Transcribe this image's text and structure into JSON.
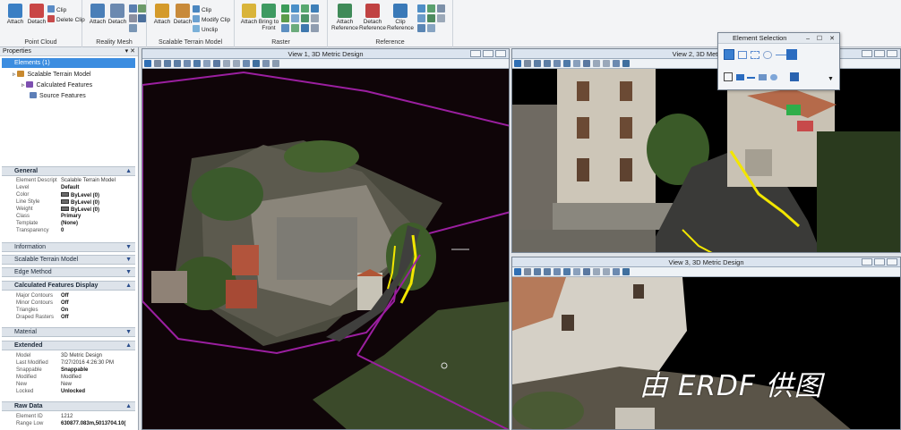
{
  "ribbon": {
    "groups": [
      {
        "label": "Point Cloud",
        "buttons": [
          "Attach",
          "Detach"
        ],
        "small": [
          "Clip",
          "Delete Clip"
        ]
      },
      {
        "label": "Reality Mesh",
        "buttons": [
          "Attach",
          "Detach"
        ]
      },
      {
        "label": "Scalable Terrain Model",
        "buttons": [
          "Attach",
          "Detach"
        ],
        "small": [
          "Clip",
          "Modify Clip",
          "Unclip"
        ]
      },
      {
        "label": "Raster",
        "buttons": [
          "Attach",
          "Bring to Front"
        ]
      },
      {
        "label": "Reference",
        "buttons": [
          "Attach Reference",
          "Detach Reference",
          "Clip Reference"
        ]
      }
    ]
  },
  "properties": {
    "title": "Properties",
    "tree": {
      "selected": "Elements (1)",
      "items": [
        "Scalable Terrain Model",
        "Calculated Features",
        "Source Features"
      ]
    },
    "sections": {
      "general": {
        "title": "General",
        "rows": [
          {
            "k": "Element Descript",
            "v": "Scalable Terrain Model"
          },
          {
            "k": "Level",
            "v": "Default"
          },
          {
            "k": "Color",
            "v": "ByLevel (0)"
          },
          {
            "k": "Line Style",
            "v": "ByLevel (0)"
          },
          {
            "k": "Weight",
            "v": "ByLevel (0)"
          },
          {
            "k": "Class",
            "v": "Primary"
          },
          {
            "k": "Template",
            "v": "(None)"
          },
          {
            "k": "Transparency",
            "v": "0"
          }
        ]
      },
      "information": "Information",
      "scalable_terrain_model": "Scalable Terrain Model",
      "edge_method": "Edge Method",
      "calc_features": {
        "title": "Calculated Features Display",
        "rows": [
          {
            "k": "Major Contours",
            "v": "Off"
          },
          {
            "k": "Minor Contours",
            "v": "Off"
          },
          {
            "k": "Triangles",
            "v": "On"
          },
          {
            "k": "Draped Rasters",
            "v": "Off"
          }
        ]
      },
      "material": "Material",
      "extended": {
        "title": "Extended",
        "rows": [
          {
            "k": "Model",
            "v": "3D Metric Design"
          },
          {
            "k": "Last Modified",
            "v": "7/27/2016 4:26:30 PM"
          },
          {
            "k": "Snappable",
            "v": "Snappable"
          },
          {
            "k": "Modified",
            "v": "Modified"
          },
          {
            "k": "New",
            "v": "New"
          },
          {
            "k": "Locked",
            "v": "Unlocked"
          }
        ]
      },
      "raw_data": {
        "title": "Raw Data",
        "rows": [
          {
            "k": "Element ID",
            "v": "1212"
          },
          {
            "k": "Range Low",
            "v": "630877.083m,5013704.10("
          }
        ]
      }
    }
  },
  "views": {
    "v1": "View 1, 3D Metric Design",
    "v2": "View 2, 3D Metric Desi",
    "v3": "View 3, 3D Metric Design"
  },
  "element_selection": {
    "title": "Element Selection"
  },
  "credit": "由 ERDF 供图",
  "colors": {
    "selection": "#3c8de0",
    "clip_box": "#9b1fa0",
    "edge_highlight": "#f2e600"
  }
}
